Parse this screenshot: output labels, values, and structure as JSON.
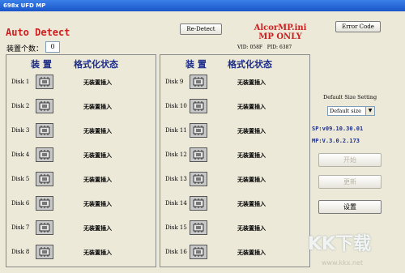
{
  "window": {
    "title": "698x UFD MP"
  },
  "header": {
    "auto_detect": "Auto Detect",
    "redetect_label": "Re-Detect",
    "ini_line1": "AlcorMP.ini",
    "ini_line2": "MP ONLY",
    "vid": "VID: 058F",
    "pid": "PID: 6387",
    "error_code_label": "Error Code",
    "device_count_label": "装置个数：",
    "device_count_value": "0"
  },
  "panels": {
    "device_header": "装 置",
    "status_header": "格式化状态"
  },
  "disks_left": [
    {
      "label": "Disk 1",
      "status": "无装置插入"
    },
    {
      "label": "Disk 2",
      "status": "无装置插入"
    },
    {
      "label": "Disk 3",
      "status": "无装置插入"
    },
    {
      "label": "Disk 4",
      "status": "无装置插入"
    },
    {
      "label": "Disk 5",
      "status": "无装置插入"
    },
    {
      "label": "Disk 6",
      "status": "无装置插入"
    },
    {
      "label": "Disk 7",
      "status": "无装置插入"
    },
    {
      "label": "Disk 8",
      "status": "无装置插入"
    }
  ],
  "disks_right": [
    {
      "label": "Disk 9",
      "status": "无装置插入"
    },
    {
      "label": "Disk 10",
      "status": "无装置插入"
    },
    {
      "label": "Disk 11",
      "status": "无装置插入"
    },
    {
      "label": "Disk 12",
      "status": "无装置插入"
    },
    {
      "label": "Disk 13",
      "status": "无装置插入"
    },
    {
      "label": "Disk 14",
      "status": "无装置插入"
    },
    {
      "label": "Disk 15",
      "status": "无装置插入"
    },
    {
      "label": "Disk 16",
      "status": "无装置插入"
    }
  ],
  "settings": {
    "size_label": "Default Size Setting",
    "size_selected": "Default size",
    "sp_version": "SP:v09.10.30.01",
    "mp_version": "MP:V.3.0.2.173",
    "start_label": "开始",
    "update_label": "更新",
    "setup_label": "设置"
  },
  "watermark": {
    "brand": "KK下载",
    "url": "www.kkx.net"
  },
  "icons": {
    "disk": "usb-chip-icon",
    "dropdown": "dropdown-arrow-icon"
  }
}
